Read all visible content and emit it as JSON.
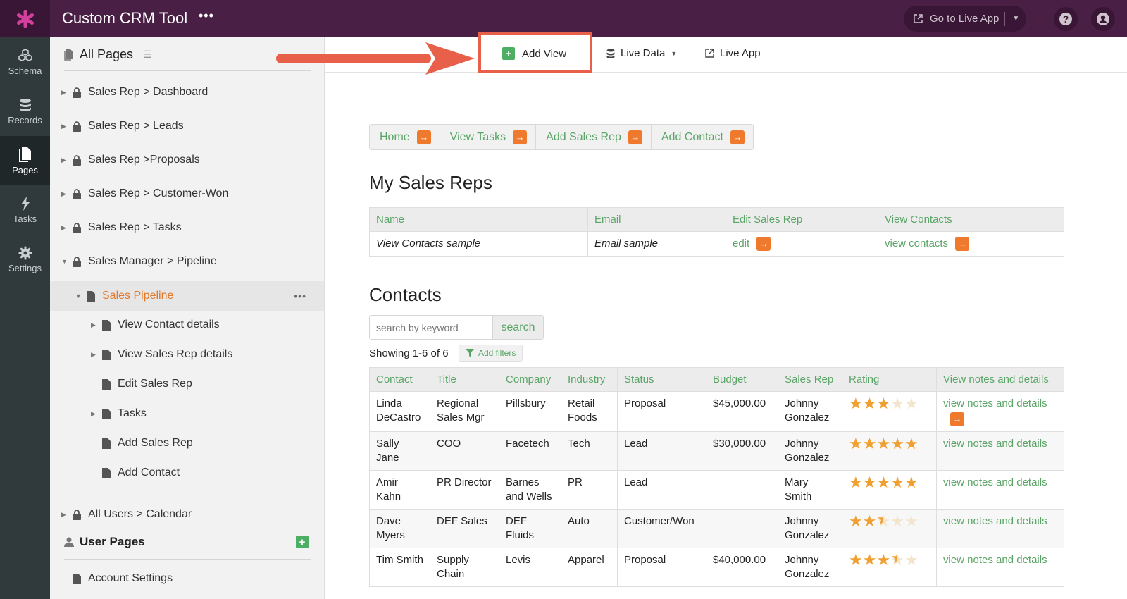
{
  "app": {
    "title": "Custom CRM Tool",
    "menu_dots": "•••"
  },
  "header": {
    "go_live_label": "Go to Live App"
  },
  "rail": [
    {
      "label": "Schema"
    },
    {
      "label": "Records"
    },
    {
      "label": "Pages"
    },
    {
      "label": "Tasks"
    },
    {
      "label": "Settings"
    }
  ],
  "tree": {
    "heading": "All Pages",
    "items": [
      {
        "label": "Sales Rep > Dashboard"
      },
      {
        "label": "Sales Rep > Leads"
      },
      {
        "label": "Sales Rep >Proposals"
      },
      {
        "label": "Sales Rep > Customer-Won"
      },
      {
        "label": "Sales Rep > Tasks"
      },
      {
        "label": "Sales Manager > Pipeline"
      },
      {
        "label": "Sales Pipeline"
      },
      {
        "label": "View Contact details"
      },
      {
        "label": "View Sales Rep details"
      },
      {
        "label": "Edit Sales Rep"
      },
      {
        "label": "Tasks"
      },
      {
        "label": "Add Sales Rep"
      },
      {
        "label": "Add Contact"
      },
      {
        "label": "All Users > Calendar"
      }
    ],
    "user_pages_heading": "User Pages",
    "user_pages": [
      {
        "label": "Account Settings"
      }
    ]
  },
  "toolbar": {
    "add_view": "Add View",
    "live_data": "Live Data",
    "live_app": "Live App"
  },
  "page": {
    "menu": [
      "Home",
      "View Tasks",
      "Add Sales Rep",
      "Add Contact"
    ],
    "reps_heading": "My Sales Reps",
    "reps_columns": [
      "Name",
      "Email",
      "Edit Sales Rep",
      "View Contacts"
    ],
    "reps_row": {
      "name": "View Contacts sample",
      "email": "Email sample",
      "edit": "edit",
      "view": "view contacts"
    },
    "contacts_heading": "Contacts",
    "search_placeholder": "search by keyword",
    "search_button": "search",
    "showing": "Showing 1-6 of 6",
    "add_filters": "Add filters",
    "contacts_columns": [
      "Contact",
      "Title",
      "Company",
      "Industry",
      "Status",
      "Budget",
      "Sales Rep",
      "Rating",
      "View notes and details"
    ],
    "contacts": [
      {
        "contact": "Linda DeCastro",
        "title": "Regional Sales Mgr",
        "company": "Pillsbury",
        "industry": "Retail Foods",
        "status": "Proposal",
        "budget": "$45,000.00",
        "rep": "Johnny Gonzalez",
        "rating": 3,
        "link": "view notes and details"
      },
      {
        "contact": "Sally Jane",
        "title": "COO",
        "company": "Facetech",
        "industry": "Tech",
        "status": "Lead",
        "budget": "$30,000.00",
        "rep": "Johnny Gonzalez",
        "rating": 5,
        "link": "view notes and details"
      },
      {
        "contact": "Amir Kahn",
        "title": "PR Director",
        "company": "Barnes and Wells",
        "industry": "PR",
        "status": "Lead",
        "budget": "",
        "rep": "Mary Smith",
        "rating": 5,
        "link": "view notes and details"
      },
      {
        "contact": "Dave Myers",
        "title": "DEF Sales",
        "company": "DEF Fluids",
        "industry": "Auto",
        "status": "Customer/Won",
        "budget": "",
        "rep": "Johnny Gonzalez",
        "rating": 2.5,
        "link": "view notes and details"
      },
      {
        "contact": "Tim Smith",
        "title": "Supply Chain",
        "company": "Levis",
        "industry": "Apparel",
        "status": "Proposal",
        "budget": "$40,000.00",
        "rep": "Johnny Gonzalez",
        "rating": 3.5,
        "link": "view notes and details"
      }
    ]
  },
  "colors": {
    "header": "#4a1f45",
    "rail": "#303a3c",
    "accent_green": "#5aa566",
    "accent_orange": "#ef7a2e",
    "callout": "#e8604a"
  }
}
